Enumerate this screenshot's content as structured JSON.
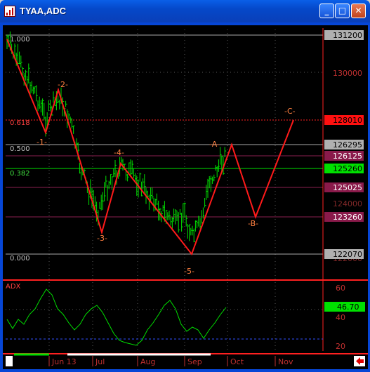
{
  "window": {
    "title": "TYAA,ADC",
    "minimize_glyph": "_",
    "maximize_glyph": "□",
    "close_glyph": "✕"
  },
  "price_axis_labels": [
    "131200",
    "130000",
    "128010",
    "126295",
    "126125",
    "125260",
    "125025",
    "123260",
    "122070"
  ],
  "fib_labels": [
    "1.000",
    "0.618",
    "0.500",
    "0.382",
    "0.000"
  ],
  "wave_labels": [
    "-1-",
    "-2-",
    "-3-",
    "-4-",
    "-5-",
    "-A-",
    "-B-",
    "-C-"
  ],
  "adx": {
    "title": "ADX",
    "axis_labels": [
      "60",
      "40",
      "20"
    ],
    "current_value": "46.70"
  },
  "date_labels": [
    "Jun 13",
    "Jul",
    "Aug",
    "Sep",
    "Oct",
    "Nov"
  ],
  "colors": {
    "background": "#000000",
    "price_bars": "#00e000",
    "wave_line": "#ff1a1a",
    "adx_line": "#00e000",
    "label_orange": "#ff8040",
    "axis_text": "#c03030"
  },
  "chart_data": {
    "type": "line",
    "title": "TYAA,ADC",
    "x": [
      "Jun 13",
      "Jul",
      "Aug",
      "Sep",
      "Oct",
      "Nov"
    ],
    "ylim": [
      121500,
      131500
    ],
    "elliott_waves": [
      {
        "name": "start",
        "y": 131200
      },
      {
        "name": "-1-",
        "y": 127600
      },
      {
        "name": "-2-",
        "y": 129700
      },
      {
        "name": "-3-",
        "y": 123400
      },
      {
        "name": "-4-",
        "y": 125300
      },
      {
        "name": "-5-",
        "y": 122070
      },
      {
        "name": "-A-",
        "y": 126295
      },
      {
        "name": "-B-",
        "y": 123260
      },
      {
        "name": "-C-",
        "y": 128010
      }
    ],
    "fib_levels": [
      {
        "label": "1.000",
        "y": 131200
      },
      {
        "label": "0.618",
        "y": 128010
      },
      {
        "label": "0.500",
        "y": 126295
      },
      {
        "label": "0.382",
        "y": 125260
      },
      {
        "label": "0.000",
        "y": 122070
      }
    ],
    "horizontal_levels": [
      131200,
      130000,
      128010,
      126295,
      126125,
      125260,
      125025,
      123260,
      122070
    ],
    "adx": {
      "ylim": [
        15,
        70
      ],
      "current": 46.7,
      "reference_lines": [
        60,
        25
      ]
    }
  }
}
